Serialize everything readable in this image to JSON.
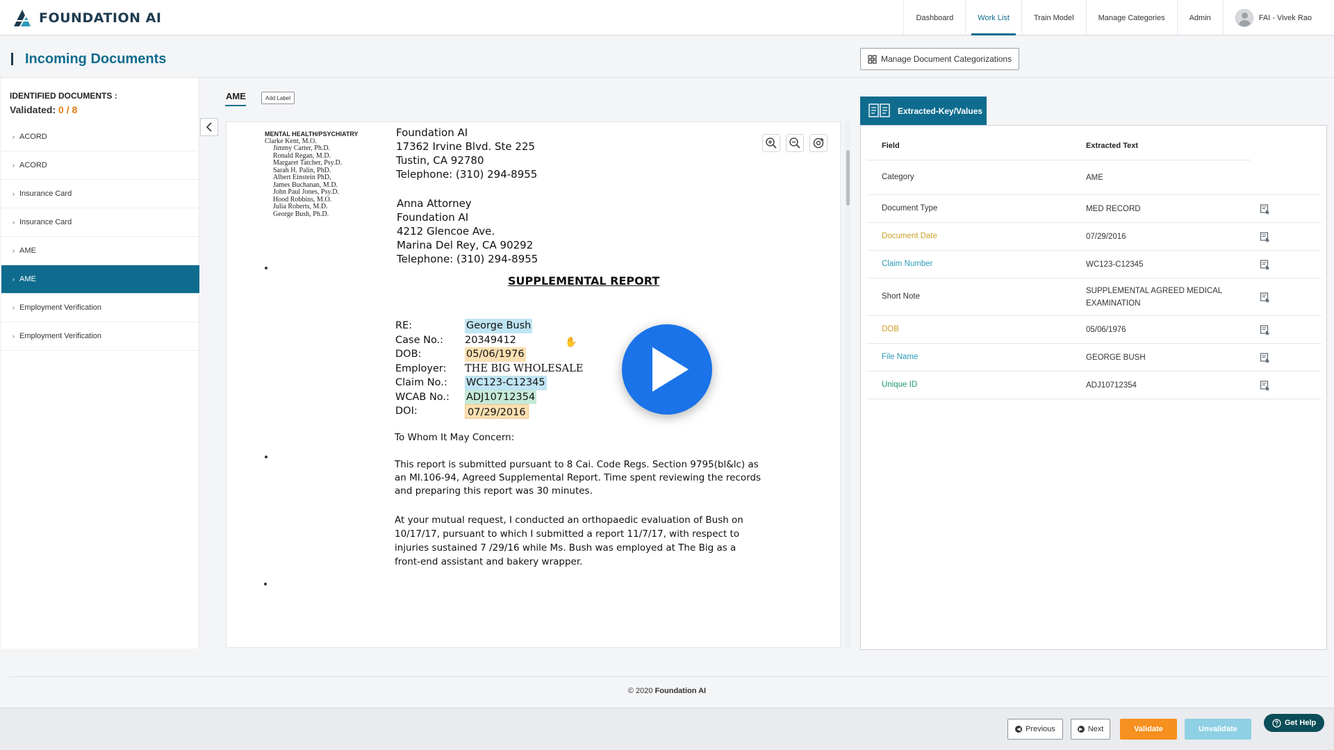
{
  "app": {
    "logo_text": "FOUNDATION AI"
  },
  "nav": {
    "items": [
      {
        "label": "Dashboard",
        "active": false
      },
      {
        "label": "Work List",
        "active": true
      },
      {
        "label": "Train Model",
        "active": false
      },
      {
        "label": "Manage Categories",
        "active": false
      },
      {
        "label": "Admin",
        "active": false
      }
    ],
    "user": "FAI - Vivek Rao"
  },
  "header": {
    "title": "Incoming Documents",
    "manage_button": "Manage Document Categorizations"
  },
  "sidebar": {
    "title": "IDENTIFIED DOCUMENTS :",
    "validated_label": "Validated:",
    "validated_count": "0 / 8",
    "items": [
      {
        "label": "ACORD",
        "active": false
      },
      {
        "label": "ACORD",
        "active": false
      },
      {
        "label": "Insurance Card",
        "active": false
      },
      {
        "label": "Insurance Card",
        "active": false
      },
      {
        "label": "AME",
        "active": false
      },
      {
        "label": "AME",
        "active": true
      },
      {
        "label": "Employment Verification",
        "active": false
      },
      {
        "label": "Employment Verification",
        "active": false
      }
    ]
  },
  "document": {
    "tab_label": "AME",
    "add_label_button": "Add Label",
    "staff_heading": "MENTAL HEALTH/PSYCHIATRY",
    "staff": [
      "Clarke Kent, M.O.",
      "Jimmy Carter, Ph.D.",
      "Ronald Regan, M.D.",
      "Margaret Tatcher, Psy.D.",
      "Sarah H. Palin, PhD.",
      "Albert Einstein PhD,",
      "James Buchanan, M.D.",
      "John Paul Jones, Psy.D.",
      "Hood Robbins, M.O.",
      "Julia Roberts, M.D.",
      "George Bush, Ph.D."
    ],
    "sender": [
      "Foundation AI",
      "17362 Irvine Blvd. Ste 225",
      "Tustin, CA 92780",
      "Telephone: (310) 294-8955"
    ],
    "recipient": [
      "Anna Attorney",
      "Foundation AI",
      "4212 Glencoe Ave.",
      "Marina Del Rey, CA 90292",
      "Telephone: (310) 294-8955"
    ],
    "report_title": "SUPPLEMENTAL REPORT",
    "fields": [
      {
        "label": "RE:",
        "value": "George Bush",
        "highlight": "blue"
      },
      {
        "label": "Case No.:",
        "value": "20349412",
        "highlight": "none"
      },
      {
        "label": "DOB:",
        "value": "05/06/1976",
        "highlight": "orange"
      },
      {
        "label": "Employer:",
        "value": "THE BIG WHOLESALE",
        "highlight": "none"
      },
      {
        "label": "Claim No.:",
        "value": "WC123-C12345",
        "highlight": "blue"
      },
      {
        "label": "WCAB No.:",
        "value": "ADJ10712354",
        "highlight": "green"
      },
      {
        "label": "DOI:",
        "value": "07/29/2016",
        "highlight": "orange-box"
      }
    ],
    "salutation": "To Whom It May Concern:",
    "paragraph1": "This report is submitted pursuant to 8 Cai. Code Regs. Section 9795(bl&lc) as an MI.106-94, Agreed Supplemental Report. Time spent reviewing the records and preparing this report was 30 minutes.",
    "paragraph2": "At your mutual request, I conducted an orthopaedic evaluation of Bush on 10/17/17, pursuant to which I submitted a report 11/7/17, with respect to injuries sustained 7 /29/16 while Ms. Bush was employed at The Big as a front-end assistant and bakery wrapper."
  },
  "kv": {
    "tab_label": "Extracted-Key/Values",
    "col_field": "Field",
    "col_text": "Extracted Text",
    "rows": [
      {
        "field": "Category",
        "value": "AME",
        "color": "#333333",
        "has_icon": false
      },
      {
        "field": "Document Type",
        "value": "MED RECORD",
        "color": "#333333",
        "has_icon": true
      },
      {
        "field": "Document Date",
        "value": "07/29/2016",
        "color": "#c9a227",
        "has_icon": true
      },
      {
        "field": "Claim Number",
        "value": "WC123-C12345",
        "color": "#2a9bb8",
        "has_icon": true
      },
      {
        "field": "Short Note",
        "value": "SUPPLEMENTAL AGREED MEDICAL EXAMINATION",
        "color": "#333333",
        "has_icon": true
      },
      {
        "field": "DOB",
        "value": "05/06/1976",
        "color": "#d39a2a",
        "has_icon": true
      },
      {
        "field": "File Name",
        "value": "GEORGE BUSH",
        "color": "#2a9bb8",
        "has_icon": true
      },
      {
        "field": "Unique ID",
        "value": "ADJ10712354",
        "color": "#1e9a6a",
        "has_icon": true
      }
    ]
  },
  "footer": {
    "copyright_prefix": "© 2020",
    "copyright_brand": "Foundation AI"
  },
  "actions": {
    "previous": "Previous",
    "next": "Next",
    "validate": "Validate",
    "unvalidate": "Unvalidate",
    "help": "Get Help"
  },
  "colors": {
    "primary": "#0f6c8e",
    "accent": "#f6901e",
    "validated_count": "#e27c10"
  }
}
